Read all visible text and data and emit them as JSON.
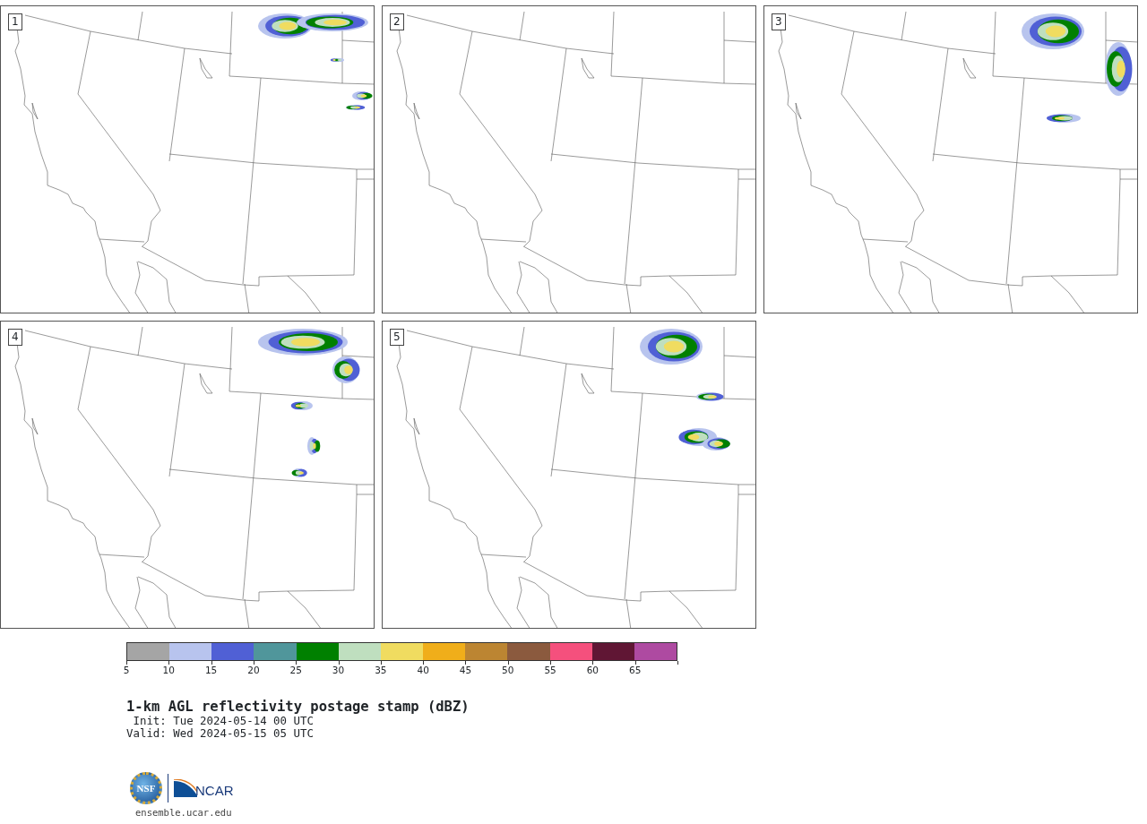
{
  "panels": [
    {
      "label": "1"
    },
    {
      "label": "2"
    },
    {
      "label": "3"
    },
    {
      "label": "4"
    },
    {
      "label": "5"
    }
  ],
  "colorbar": {
    "bins": [
      {
        "color": "#a5a5a5"
      },
      {
        "color": "#b8c4ee"
      },
      {
        "color": "#5060d5"
      },
      {
        "color": "#50969b"
      },
      {
        "color": "#008000"
      },
      {
        "color": "#bfdfbf"
      },
      {
        "color": "#f0dc60"
      },
      {
        "color": "#f0ae1a"
      },
      {
        "color": "#bc8532"
      },
      {
        "color": "#8b5a3e"
      },
      {
        "color": "#f5507d"
      },
      {
        "color": "#601634"
      },
      {
        "color": "#ae4aa1"
      }
    ],
    "ticks": [
      "5",
      "10",
      "15",
      "20",
      "25",
      "30",
      "35",
      "40",
      "45",
      "50",
      "55",
      "60",
      "65"
    ]
  },
  "title": "1-km AGL reflectivity postage stamp (dBZ)",
  "init": " Init: Tue 2024-05-14 00 UTC",
  "valid": "Valid: Wed 2024-05-15 05 UTC",
  "logos": {
    "nsf_text": "NSF",
    "ncar_text": "NCAR"
  },
  "url": "ensemble.ucar.edu"
}
